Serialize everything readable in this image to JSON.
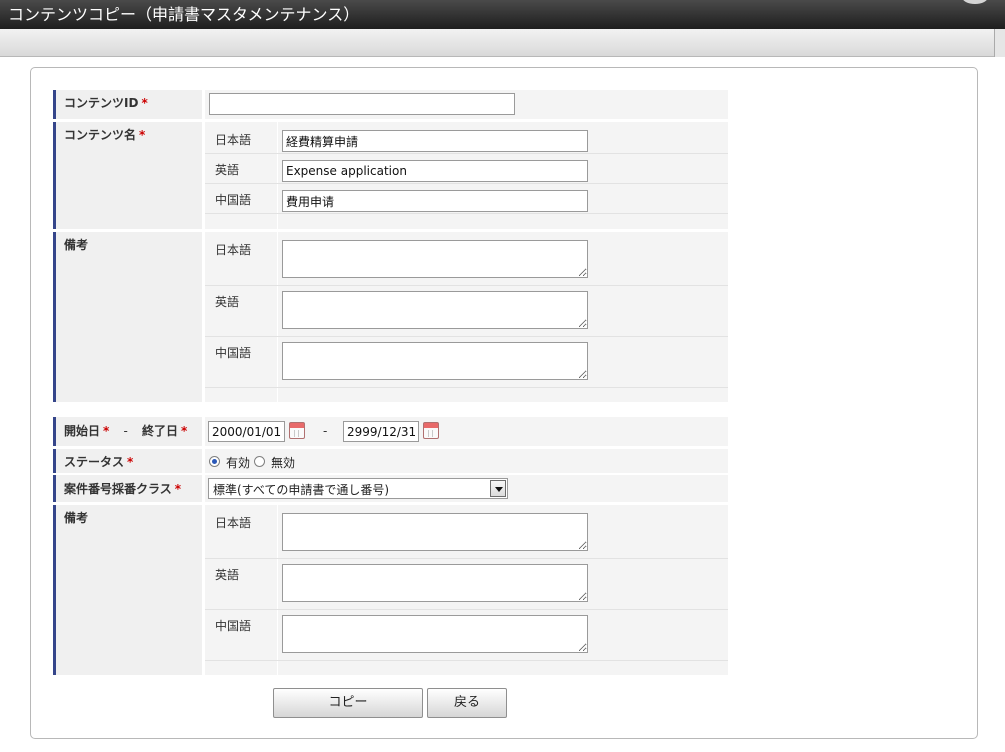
{
  "window": {
    "title": "コンテンツコピー（申請書マスタメンテナンス）"
  },
  "form": {
    "content_id": {
      "label": "コンテンツID",
      "value": ""
    },
    "content_name": {
      "label": "コンテンツ名",
      "ja": {
        "label": "日本語",
        "value": "経費精算申請"
      },
      "en": {
        "label": "英語",
        "value": "Expense application"
      },
      "zh": {
        "label": "中国語",
        "value": "費用申请"
      }
    },
    "note1": {
      "label": "備考",
      "ja": {
        "label": "日本語",
        "value": ""
      },
      "en": {
        "label": "英語",
        "value": ""
      },
      "zh": {
        "label": "中国語",
        "value": ""
      }
    },
    "period": {
      "start_label": "開始日",
      "sep_label": "-",
      "end_label": "終了日",
      "start_value": "2000/01/01",
      "range_sep": "-",
      "end_value": "2999/12/31"
    },
    "status": {
      "label": "ステータス",
      "options": [
        {
          "label": "有効",
          "selected": true
        },
        {
          "label": "無効",
          "selected": false
        }
      ]
    },
    "numbering": {
      "label": "案件番号採番クラス",
      "selected": "標準(すべての申請書で通し番号)"
    },
    "note2": {
      "label": "備考",
      "ja": {
        "label": "日本語",
        "value": ""
      },
      "en": {
        "label": "英語",
        "value": ""
      },
      "zh": {
        "label": "中国語",
        "value": ""
      }
    },
    "required_mark": "*"
  },
  "buttons": {
    "copy": "コピー",
    "back": "戻る"
  },
  "colors": {
    "title_bg": "#2b2b2b",
    "accent": "#35458a",
    "required": "#cc0000",
    "radio_on": "#2a58b8",
    "calendar": "#e86a6a"
  },
  "icons": {
    "calendar": "calendar-icon",
    "dropdown": "chevron-down-icon"
  }
}
